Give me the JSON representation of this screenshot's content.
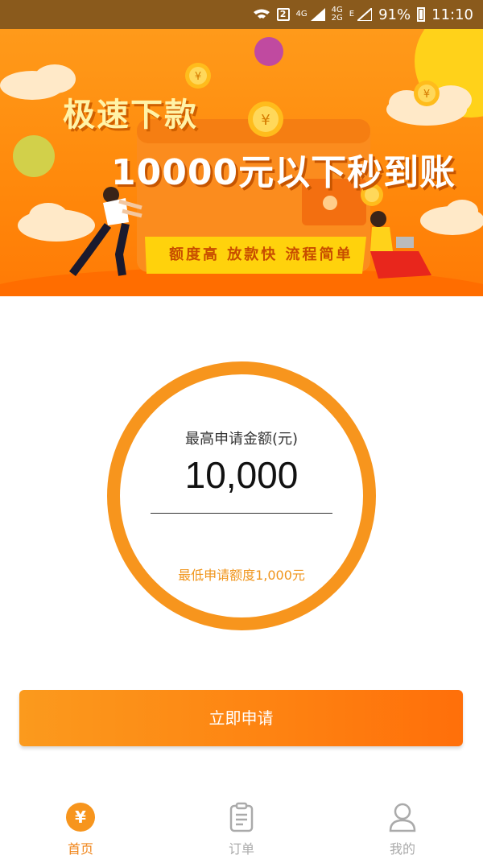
{
  "status_bar": {
    "network_badge": "2",
    "net_4g_a": "4G",
    "net_4g_b": "4G",
    "net_2g": "2G",
    "net_e": "E",
    "battery": "91%",
    "time": "11:10"
  },
  "banner": {
    "title_1": "极速下款",
    "title_2": "10000元以下秒到账",
    "tagline": "额度高 放款快 流程简单"
  },
  "amount_card": {
    "label": "最高申请金额(元)",
    "value": "10,000",
    "min_note": "最低申请额度1,000元"
  },
  "apply_button": {
    "label": "立即申请"
  },
  "bottom_nav": {
    "items": [
      {
        "label": "首页",
        "icon": "yen-coin-icon",
        "active": true
      },
      {
        "label": "订单",
        "icon": "clipboard-icon",
        "active": false
      },
      {
        "label": "我的",
        "icon": "user-icon",
        "active": false
      }
    ]
  },
  "colors": {
    "accent": "#f7951d",
    "accent_dark": "#ff6f0a",
    "status_bar": "#8a5a1c",
    "inactive": "#aaaaaa"
  }
}
